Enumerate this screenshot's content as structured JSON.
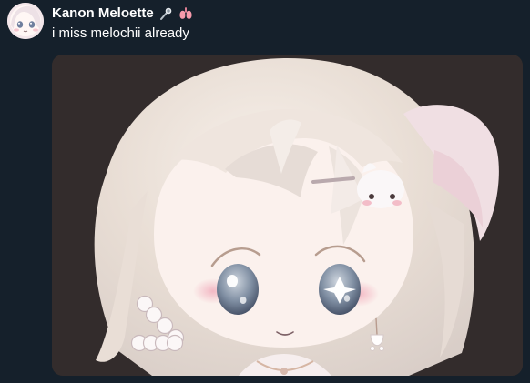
{
  "post": {
    "author": {
      "display_name": "Kanon Meloette",
      "avatar_icon": "chibi-avatar-icon",
      "badge_icons": [
        "microphone-emoji-icon",
        "lungs-emoji-icon"
      ]
    },
    "text": "i miss melochii already",
    "media": {
      "type": "image",
      "alt": "",
      "icon": "chibi-character-artwork"
    }
  },
  "colors": {
    "background": "#15202b",
    "text_primary": "#ffffff",
    "media_background": "#2f2a2a"
  }
}
